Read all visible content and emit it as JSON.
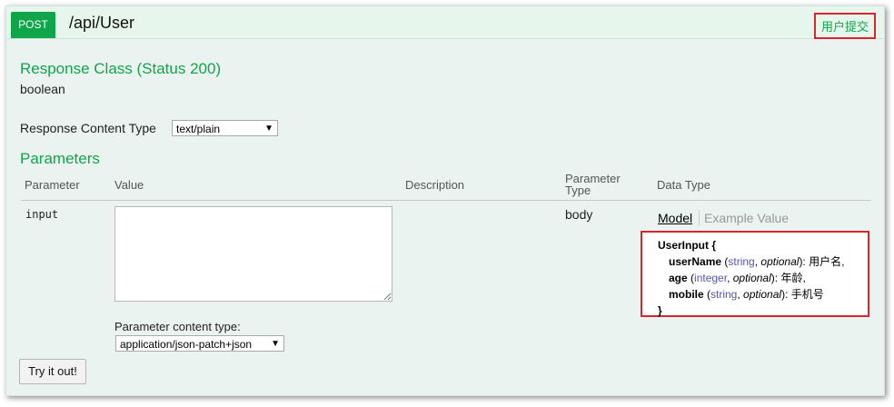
{
  "endpoint": {
    "method": "POST",
    "path": "/api/User",
    "summary": "用户提交"
  },
  "response_class": {
    "title": "Response Class (Status 200)",
    "type": "boolean"
  },
  "response_content_type": {
    "label": "Response Content Type",
    "selected": "text/plain"
  },
  "parameters": {
    "title": "Parameters",
    "headers": {
      "parameter": "Parameter",
      "value": "Value",
      "description": "Description",
      "parameter_type_line1": "Parameter",
      "parameter_type_line2": "Type",
      "data_type": "Data Type"
    },
    "row": {
      "name": "input",
      "param_type": "body",
      "content_type_label": "Parameter content type:",
      "content_type_selected": "application/json-patch+json"
    }
  },
  "model": {
    "tab_model": "Model",
    "tab_example": "Example Value",
    "name": "UserInput",
    "open_brace": "{",
    "close_brace": "}",
    "fields": [
      {
        "name": "userName",
        "type": "string",
        "optional": "optional",
        "desc": "用户名,"
      },
      {
        "name": "age",
        "type": "integer",
        "optional": "optional",
        "desc": "年龄,"
      },
      {
        "name": "mobile",
        "type": "string",
        "optional": "optional",
        "desc": "手机号"
      }
    ]
  },
  "try_button": "Try it out!",
  "colors": {
    "accent": "#10a54a",
    "highlight": "#d8262c",
    "background": "#ebf3f0"
  }
}
